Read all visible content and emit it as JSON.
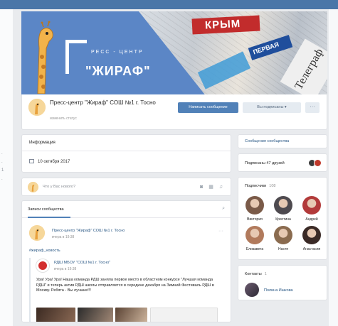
{
  "left_strip_marks": [
    ".",
    ".",
    "1",
    "."
  ],
  "cover": {
    "logo_press_text": "РЕСС - ЦЕНТР",
    "logo_name_text": "\"ЖИРАФ\"",
    "paper_red": "КРЫМ",
    "paper_blue": "ПЕРВАЯ",
    "paper_dark": "Телеграф"
  },
  "header": {
    "title": "Пресс-центр \"Жираф\" СОШ №1 г. Тосно",
    "status": "изменить статус",
    "message_button": "Написать сообщение",
    "subscribed_button": "Вы подписаны ▾",
    "more_button": "···"
  },
  "info": {
    "title": "Информация",
    "date": "10 октября 2017"
  },
  "composer": {
    "placeholder": "Что у Вас нового?",
    "icons": "◙ ▦ ♫"
  },
  "posts": {
    "title": "Записи сообщества",
    "search_icon": "⌕",
    "author": "Пресс-центр \"Жираф\" СОШ №1 г. Тосно",
    "time": "вчера в 19:38",
    "more": "···",
    "hashtag": "#жираф_новость",
    "repost_author": "РДШ МБОУ \"СОШ №1 г. Тосно\"",
    "repost_time": "вчера в 19:38",
    "repost_text": "Ура! Ура! Ура! Наша команда РДШ заняла первое место в областном конкурсе \"Лучшая команда РДШ\" и теперь актив РДШ школы отправляется в середине декабря на Зимний Фестиваль РДШ в Москву. Ребята - Вы лучшие!!!"
  },
  "right": {
    "community_messages": "Сообщения сообщества",
    "friends_subscribed": "Подписаны 47 друзей",
    "subscribers_title": "Подписчики",
    "subscribers_count": "108",
    "subscribers": [
      {
        "name": "Виктория",
        "color": "#7a5a48"
      },
      {
        "name": "Кристина",
        "color": "#4e4a4f"
      },
      {
        "name": "Андрей",
        "color": "#b23a3a"
      },
      {
        "name": "Елизавета",
        "color": "#b17a5c"
      },
      {
        "name": "Настя",
        "color": "#8a6b4f"
      },
      {
        "name": "Анастасия",
        "color": "#3a2a26"
      }
    ],
    "contacts_title": "Контакты",
    "contacts_count": "1",
    "contact_name": "Полина Ишкова"
  }
}
